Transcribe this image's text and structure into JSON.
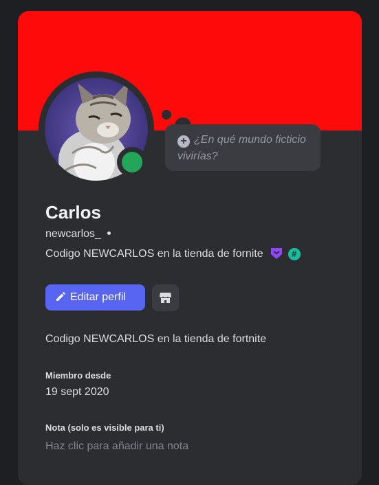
{
  "profile": {
    "display_name": "Carlos",
    "username": "newcarlos_",
    "custom_status": "Codigo NEWCARLOS en la tienda de fornite",
    "status": "online",
    "status_color": "#23a55a",
    "banner_color": "#ff0a0a",
    "avatar": "kitten-photo"
  },
  "thought_bubble": {
    "placeholder": "¿En qué mundo ficticio vivirías?",
    "icon": "plus-circle-icon"
  },
  "badges": [
    {
      "name": "twitch-badge-icon",
      "color": "#9146ff"
    },
    {
      "name": "hashtag-badge-icon",
      "color": "#1abc9c"
    }
  ],
  "actions": {
    "edit_label": "Editar perfil",
    "edit_icon": "pencil-icon",
    "edit_color": "#5865f2",
    "shop_icon": "shop-icon"
  },
  "about": {
    "text": "Codigo NEWCARLOS en la tienda de fortnite"
  },
  "member_since": {
    "label": "Miembro desde",
    "value": "19 sept 2020"
  },
  "note": {
    "label": "Nota (solo es visible para ti)",
    "placeholder": "Haz clic para añadir una nota"
  }
}
